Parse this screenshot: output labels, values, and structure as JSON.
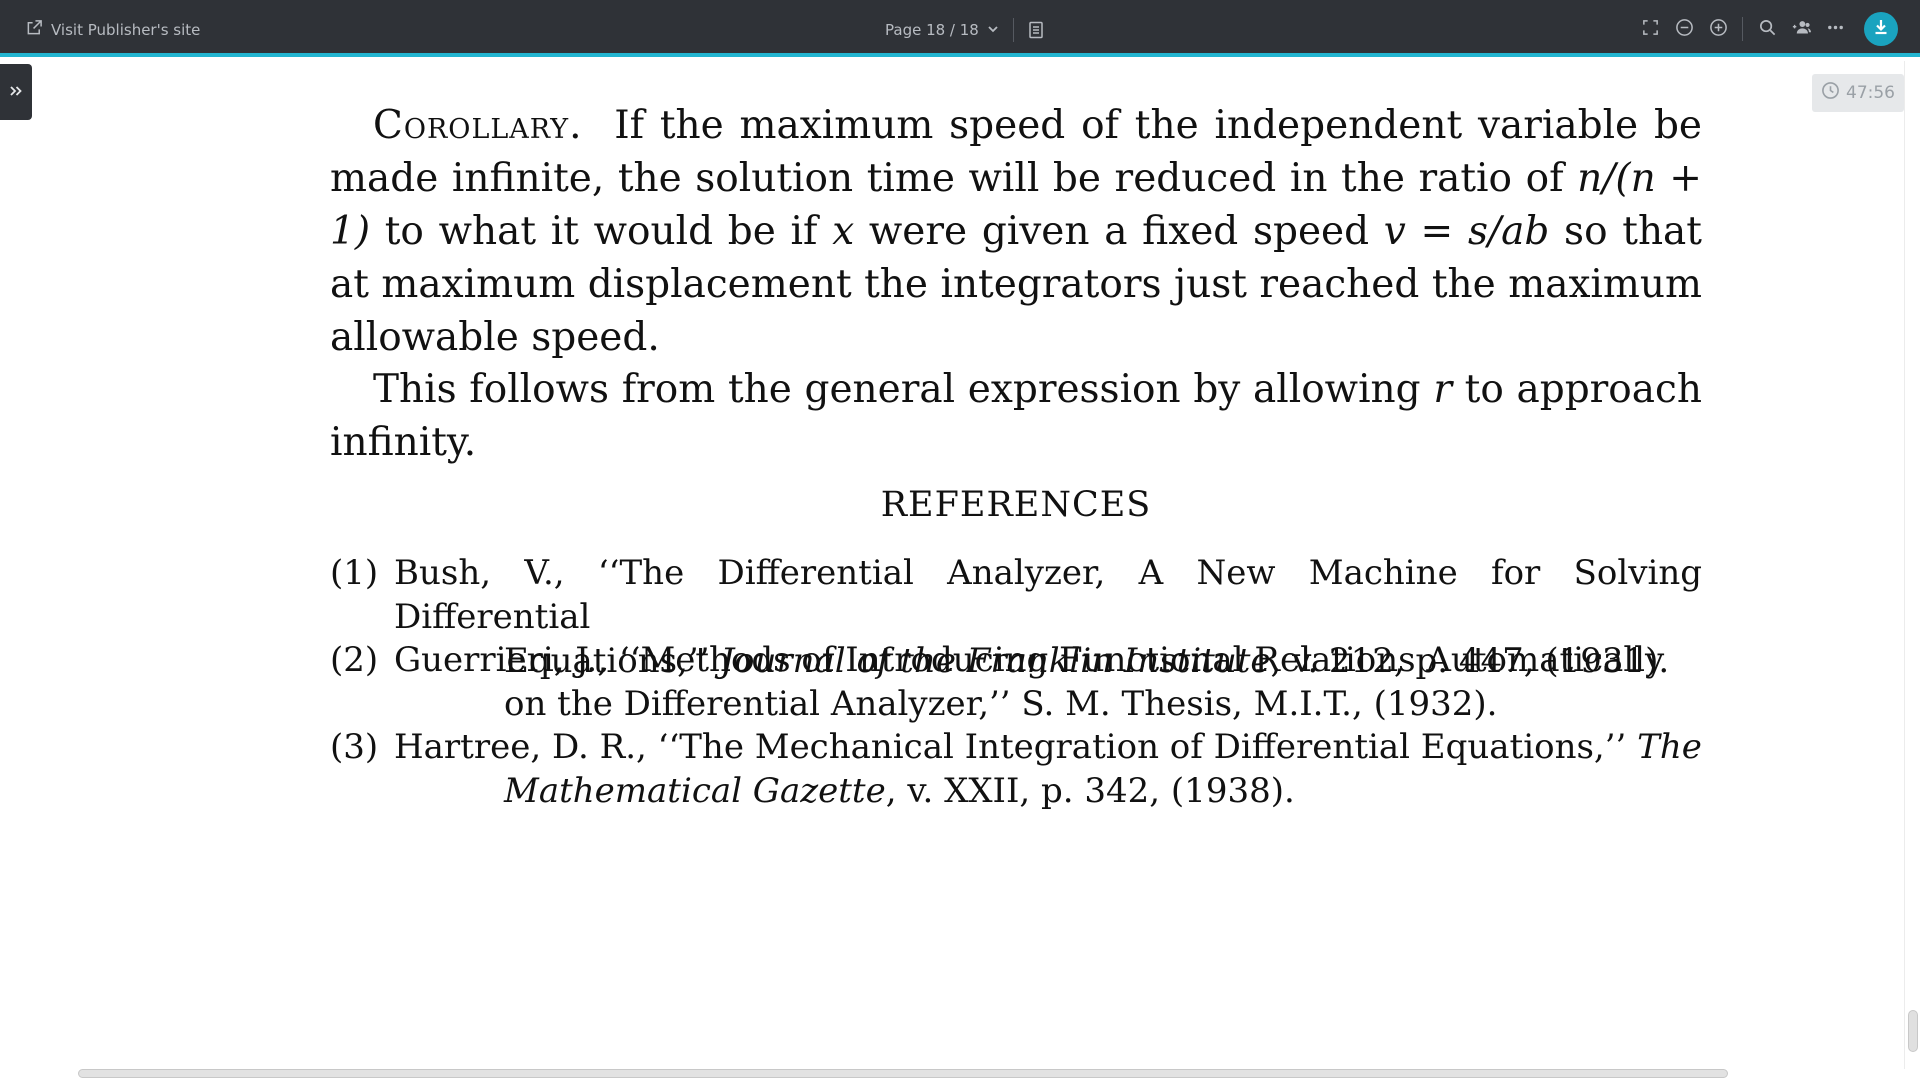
{
  "toolbar": {
    "visit_publisher": "Visit Publisher's site",
    "page_indicator": "Page 18 / 18",
    "icons": [
      "external-link-icon",
      "chevron-down-icon",
      "thumbnails-icon",
      "fullscreen-icon",
      "zoom-out-icon",
      "zoom-in-icon",
      "search-icon",
      "share-users-icon",
      "more-icon",
      "download-icon"
    ],
    "accent_color": "#22b5d0",
    "background_color": "#2f3237"
  },
  "timer": {
    "value": "47:56"
  },
  "document": {
    "corollary_label": "Corollary.",
    "corollary_text_a": "If the maximum speed of the independent variable be made infinite, the solution time will be reduced in the ratio of ",
    "ratio_expr": "n/(n + 1)",
    "corollary_text_b": " to what it would be if ",
    "var_x": "x",
    "corollary_text_c": " were given a fixed speed ",
    "speed_expr": "v = s/ab",
    "corollary_text_d": " so that at maximum displacement the integrators just reached the maximum allowable speed.",
    "para2_text_a": "This follows from the general expression by allowing ",
    "var_r": "r",
    "para2_text_b": " to approach infinity.",
    "references_heading": "REFERENCES",
    "references": [
      {
        "num": "(1)",
        "line1": "Bush, V., ‘‘The Differential Analyzer, A New Machine for Solving Differential",
        "line2_plain": "Equations,’’ ",
        "line2_italic": "Journal of the Franklin Institute",
        "line2_tail": ", v. 212, p. 447, (1931)."
      },
      {
        "num": "(2)",
        "line1": "Guerrieri, J., ‘‘Methods of Introducing Functional Relations Automatically",
        "line2_plain": "on the Differential Analyzer,’’ S. M. Thesis, M.I.T., (1932)."
      },
      {
        "num": "(3)",
        "line1_plain": "Hartree, D. R., ‘‘The Mechanical Integration of Differential Equations,’’ ",
        "line1_italic": "The",
        "line2_italic": "Mathematical Gazette",
        "line2_tail": ", v. XXII, p. 342, (1938)."
      }
    ]
  }
}
